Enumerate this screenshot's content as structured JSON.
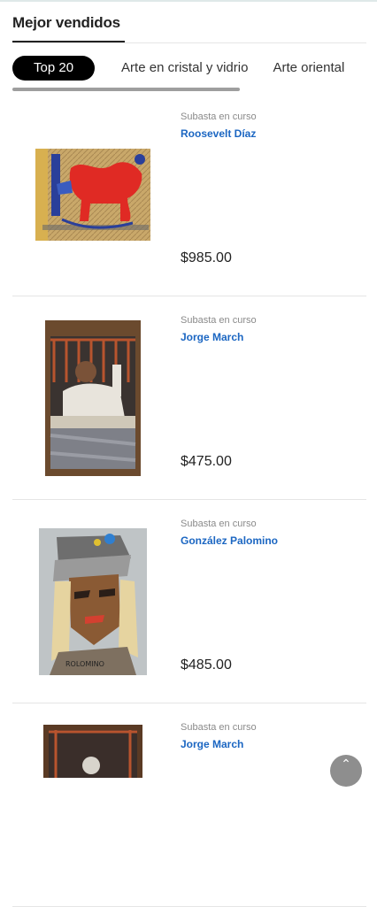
{
  "section": {
    "title": "Mejor vendidos"
  },
  "tabs": [
    {
      "label": "Top 20",
      "active": true
    },
    {
      "label": "Arte en cristal y vidrio",
      "active": false
    },
    {
      "label": "Arte oriental",
      "active": false
    }
  ],
  "products": [
    {
      "status": "Subasta en curso",
      "artist": "Roosevelt Díaz",
      "price": "$985.00",
      "image": "painting-red-figure"
    },
    {
      "status": "Subasta en curso",
      "artist": "Jorge March",
      "price": "$475.00",
      "image": "painting-man-at-window"
    },
    {
      "status": "Subasta en curso",
      "artist": "González Palomino",
      "price": "$485.00",
      "image": "painting-cubist-portrait"
    },
    {
      "status": "Subasta en curso",
      "artist": "Jorge March",
      "price": "",
      "image": "painting-window-figure"
    }
  ],
  "scroll_top": {
    "icon": "chevron-up-icon"
  },
  "colors": {
    "accent_link": "#1b66c2",
    "active_tab_bg": "#000000",
    "scrollbar": "#9e9e9e"
  }
}
